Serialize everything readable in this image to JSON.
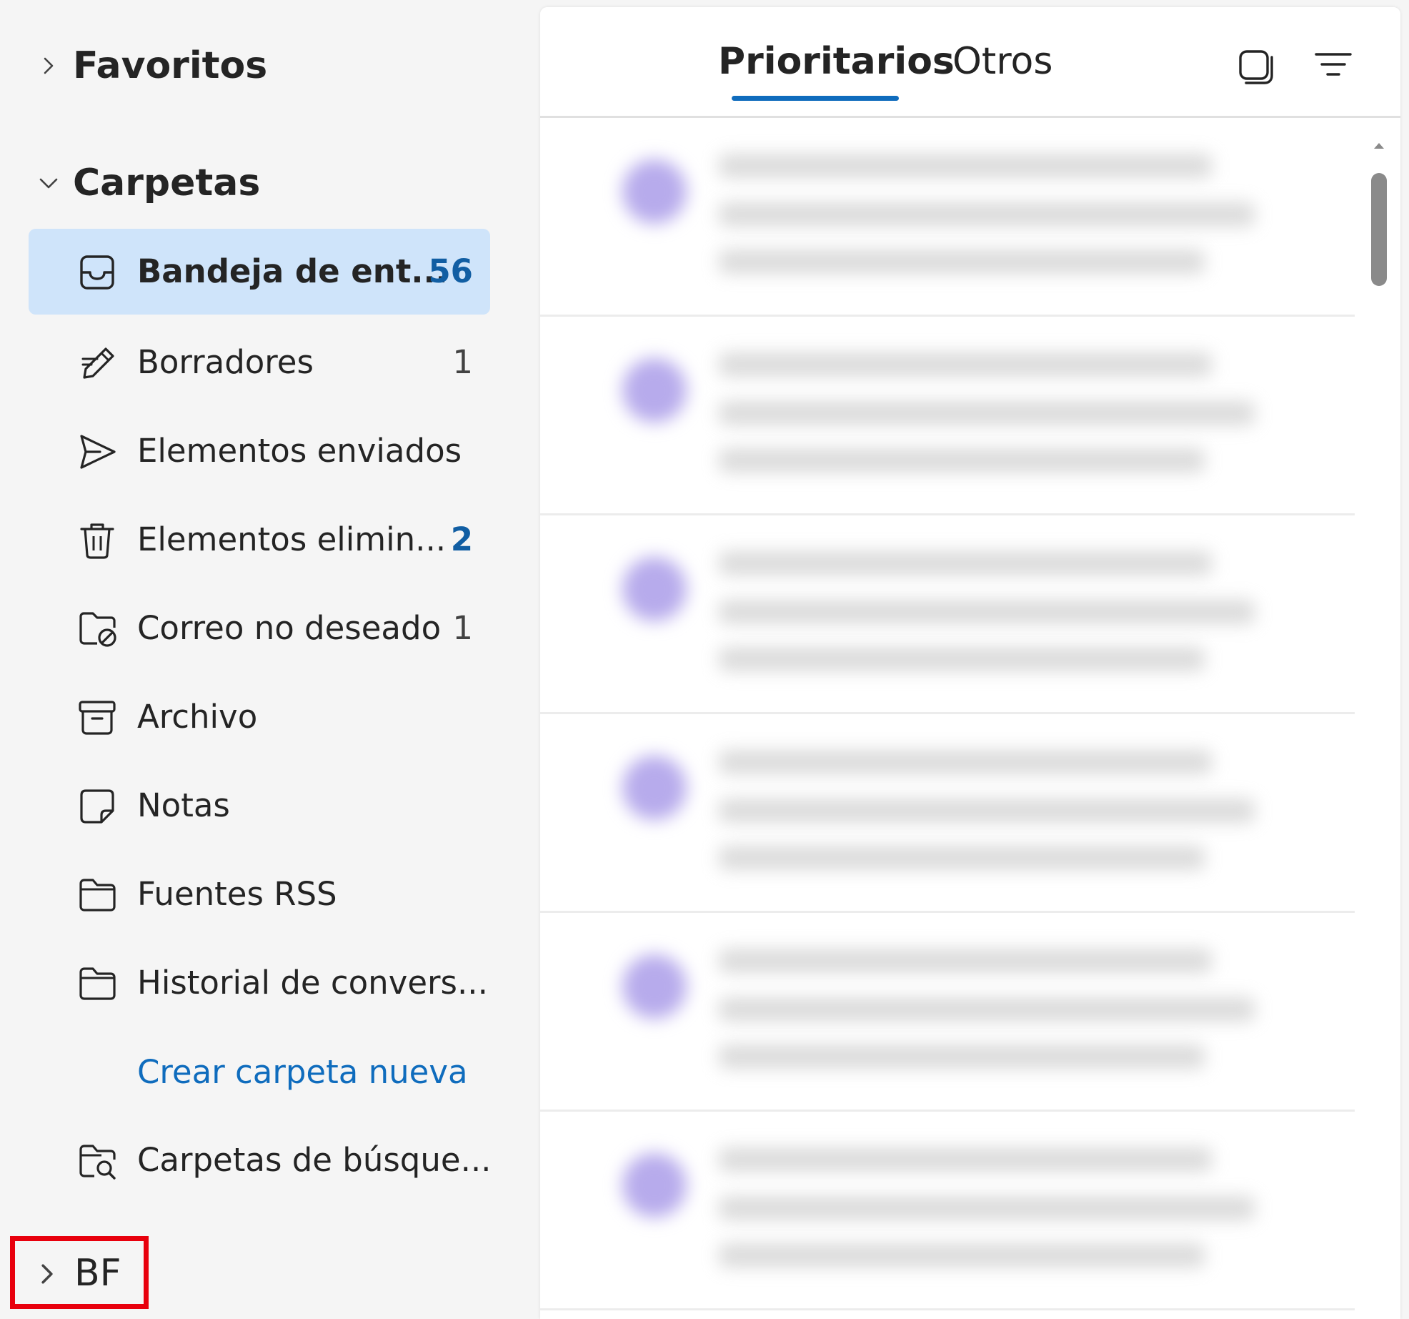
{
  "sidebar": {
    "favorites": {
      "label": "Favoritos",
      "expanded": false
    },
    "folders_header": {
      "label": "Carpetas",
      "expanded": true
    },
    "items": [
      {
        "label": "Bandeja de ent...",
        "count": "56",
        "icon": "inbox-icon",
        "selected": true,
        "count_bold": true
      },
      {
        "label": "Borradores",
        "count": "1",
        "icon": "drafts-pencil-icon",
        "selected": false,
        "count_bold": false
      },
      {
        "label": "Elementos enviados",
        "count": "",
        "icon": "send-icon",
        "selected": false,
        "count_bold": false
      },
      {
        "label": "Elementos elimin...",
        "count": "2",
        "icon": "trash-icon",
        "selected": false,
        "count_bold": true
      },
      {
        "label": "Correo no deseado",
        "count": "1",
        "icon": "junk-folder-icon",
        "selected": false,
        "count_bold": false
      },
      {
        "label": "Archivo",
        "count": "",
        "icon": "archive-icon",
        "selected": false,
        "count_bold": false
      },
      {
        "label": "Notas",
        "count": "",
        "icon": "notes-icon",
        "selected": false,
        "count_bold": false
      },
      {
        "label": "Fuentes RSS",
        "count": "",
        "icon": "folder-icon",
        "selected": false,
        "count_bold": false
      },
      {
        "label": "Historial de convers...",
        "count": "",
        "icon": "folder-icon",
        "selected": false,
        "count_bold": false
      }
    ],
    "create_folder": "Crear carpeta nueva",
    "search_folders": {
      "label": "Carpetas de búsque...",
      "icon": "search-folder-icon"
    },
    "account": {
      "label": "BF",
      "expanded": false,
      "highlighted": true
    }
  },
  "message_list": {
    "tabs": [
      {
        "label": "Prioritarios",
        "active": true
      },
      {
        "label": "Otros",
        "active": false
      }
    ],
    "header_icons": [
      "select-mode-icon",
      "filter-icon"
    ],
    "messages_blurred": true
  },
  "colors": {
    "accent": "#0f6cbd",
    "selected_bg": "#cfe4fa",
    "highlight_box": "#e8000d",
    "avatar": "#b7abec"
  }
}
